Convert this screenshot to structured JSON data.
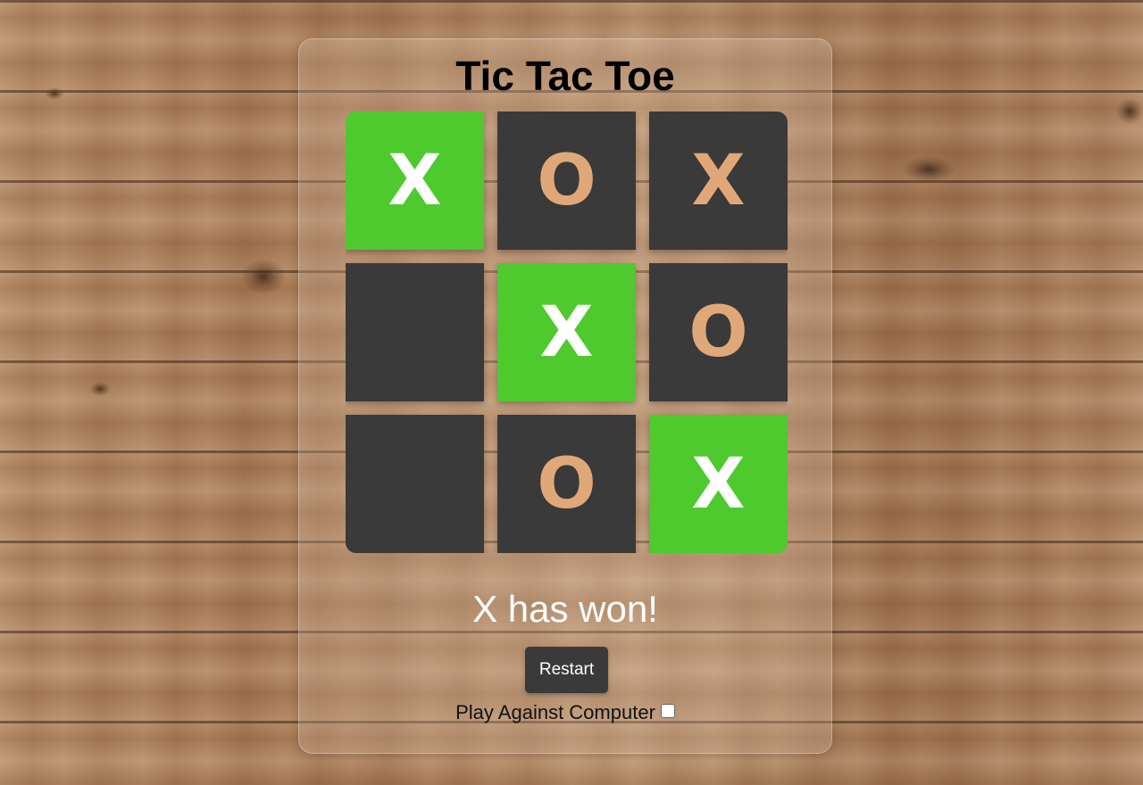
{
  "game": {
    "title": "Tic Tac Toe",
    "board": [
      [
        "X",
        "O",
        "X"
      ],
      [
        "",
        "X",
        "O"
      ],
      [
        "",
        "O",
        "X"
      ]
    ],
    "winning_cells": [
      [
        0,
        0
      ],
      [
        1,
        1
      ],
      [
        2,
        2
      ]
    ],
    "status": "X has won!",
    "restart_label": "Restart",
    "computer_label": "Play Against Computer",
    "computer_checked": false
  },
  "colors": {
    "cell_bg": "#3a3a3a",
    "win_bg": "#4ec92e",
    "mark": "#e0a878",
    "win_mark": "#ffffff"
  }
}
